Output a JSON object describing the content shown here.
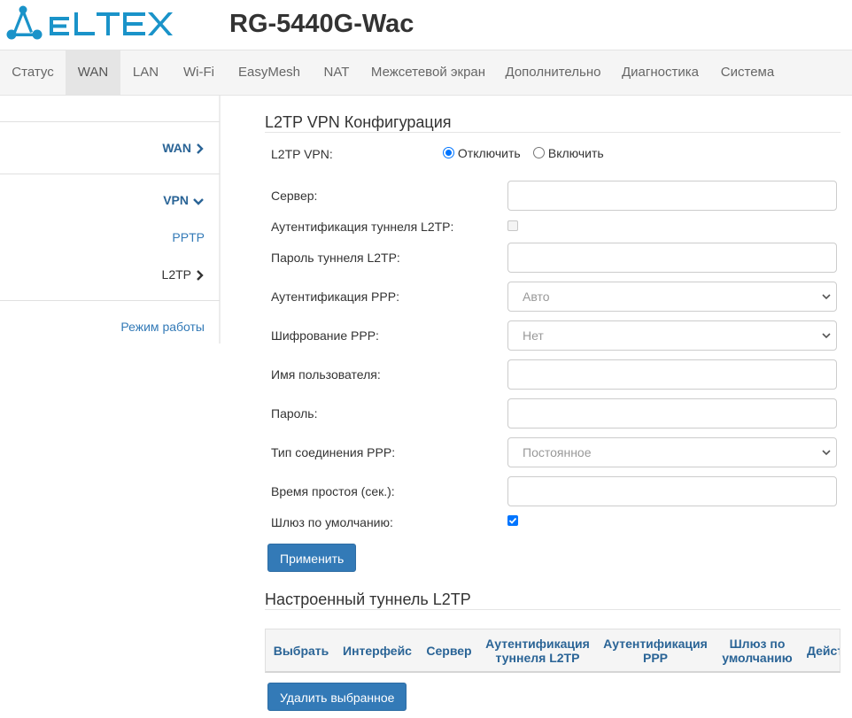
{
  "header": {
    "logo_text": "ELTEX",
    "device_model": "RG-5440G-Wac",
    "brand_color": "#1a93c9"
  },
  "topnav": {
    "items": [
      {
        "label": "Статус",
        "active": false
      },
      {
        "label": "WAN",
        "active": true
      },
      {
        "label": "LAN",
        "active": false
      },
      {
        "label": "Wi-Fi",
        "active": false
      },
      {
        "label": "EasyMesh",
        "active": false
      },
      {
        "label": "NAT",
        "active": false
      },
      {
        "label": "Межсетевой экран",
        "active": false
      },
      {
        "label": "Дополнительно",
        "active": false
      },
      {
        "label": "Диагностика",
        "active": false
      },
      {
        "label": "Система",
        "active": false
      }
    ]
  },
  "sidebar": {
    "items": [
      {
        "label": "WAN",
        "icon": "chevron-right-icon"
      },
      {
        "label": "VPN",
        "icon": "chevron-down-icon"
      },
      {
        "label": "PPTP"
      },
      {
        "label": "L2TP",
        "icon": "chevron-right-icon"
      },
      {
        "label": "Режим работы"
      }
    ]
  },
  "config": {
    "title": "L2TP VPN Конфигурация",
    "vpn_label": "L2TP VPN:",
    "option_disable": "Отключить",
    "option_enable": "Включить",
    "selected": "Отключить",
    "server_label": "Сервер:",
    "server_value": "",
    "tunnel_auth_label": "Аутентификация туннеля L2TP:",
    "tunnel_auth_checked": false,
    "tunnel_password_label": "Пароль туннеля L2TP:",
    "tunnel_password_value": "",
    "ppp_auth_label": "Аутентификация PPP:",
    "ppp_auth_value": "Авто",
    "ppp_encryption_label": "Шифрование PPP:",
    "ppp_encryption_value": "Нет",
    "username_label": "Имя пользователя:",
    "username_value": "",
    "password_label": "Пароль:",
    "password_value": "",
    "ppp_conn_type_label": "Тип соединения PPP:",
    "ppp_conn_type_value": "Постоянное",
    "idle_time_label": "Время простоя (сек.):",
    "idle_time_value": "",
    "default_gw_label": "Шлюз по умолчанию:",
    "default_gw_checked": true,
    "apply_button": "Применить"
  },
  "tunnels": {
    "title": "Настроенный туннель L2TP",
    "columns": [
      {
        "line1": "Выбрать",
        "line2": ""
      },
      {
        "line1": "Интерфейс",
        "line2": ""
      },
      {
        "line1": "Сервер",
        "line2": ""
      },
      {
        "line1": "Аутентификация",
        "line2": "туннеля L2TP"
      },
      {
        "line1": "Аутентификация",
        "line2": "PPP"
      },
      {
        "line1": "Шлюз по",
        "line2": "умолчанию"
      },
      {
        "line1": "Дейст",
        "line2": ""
      }
    ],
    "rows": [],
    "delete_button": "Удалить выбранное"
  },
  "colors": {
    "accent": "#337ab7",
    "link": "#2a6496",
    "checkbox": "#0075ff"
  }
}
